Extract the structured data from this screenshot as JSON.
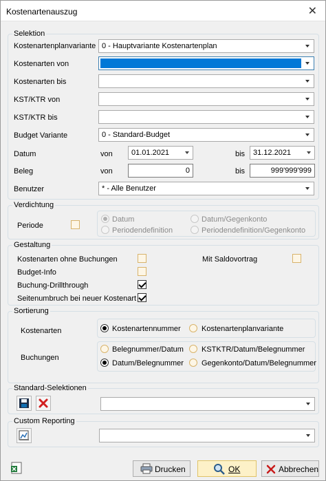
{
  "window": {
    "title": "Kostenartenauszug",
    "close_glyph": "✕"
  },
  "selektion": {
    "legend": "Selektion",
    "plan_label": "Kostenartenplanvariante",
    "plan_value": "0 - Hauptvariante Kostenartenplan",
    "von_label": "Kostenarten von",
    "bis_label": "Kostenarten bis",
    "kst_von_label": "KST/KTR von",
    "kst_bis_label": "KST/KTR bis",
    "budget_label": "Budget Variante",
    "budget_value": "0 - Standard-Budget",
    "datum_label": "Datum",
    "von_word": "von",
    "bis_word": "bis",
    "datum_von": "01.01.2021",
    "datum_bis": "31.12.2021",
    "beleg_label": "Beleg",
    "beleg_von": "0",
    "beleg_bis": "999'999'999",
    "benutzer_label": "Benutzer",
    "benutzer_value": "* - Alle Benutzer"
  },
  "verdichtung": {
    "legend": "Verdichtung",
    "periode_label": "Periode",
    "periode_checked": false,
    "options": [
      "Datum",
      "Datum/Gegenkonto",
      "Periodendefinition",
      "Periodendefinition/Gegenkonto"
    ],
    "selected": "Datum"
  },
  "gestaltung": {
    "legend": "Gestaltung",
    "items": [
      {
        "label": "Kostenarten ohne Buchungen",
        "checked": false
      },
      {
        "label": "Budget-Info",
        "checked": false
      },
      {
        "label": "Buchung-Drillthrough",
        "checked": true
      },
      {
        "label": "Seitenumbruch bei neuer Kostenart",
        "checked": true
      }
    ],
    "saldo_label": "Mit Saldovortrag",
    "saldo_checked": false
  },
  "sortierung": {
    "legend": "Sortierung",
    "kostenarten_label": "Kostenarten",
    "kostenarten_options": [
      "Kostenartennummer",
      "Kostenartenplanvariante"
    ],
    "kostenarten_selected": "Kostenartennummer",
    "buchungen_label": "Buchungen",
    "buchungen_options": [
      "Belegnummer/Datum",
      "KSTKTR/Datum/Belegnummer",
      "Datum/Belegnummer",
      "Gegenkonto/Datum/Belegnummer"
    ],
    "buchungen_selected": "Datum/Belegnummer"
  },
  "standard_selektionen": {
    "legend": "Standard-Selektionen",
    "value": ""
  },
  "custom_reporting": {
    "legend": "Custom Reporting",
    "value": ""
  },
  "footer": {
    "drucken": "Drucken",
    "ok": "OK",
    "abbrechen": "Abbrechen"
  },
  "colors": {
    "accent": "#0078d7",
    "checkbox_border": "#d8b36a",
    "ok_bg": "#fdf1c8",
    "delete_red": "#d21f1f"
  }
}
